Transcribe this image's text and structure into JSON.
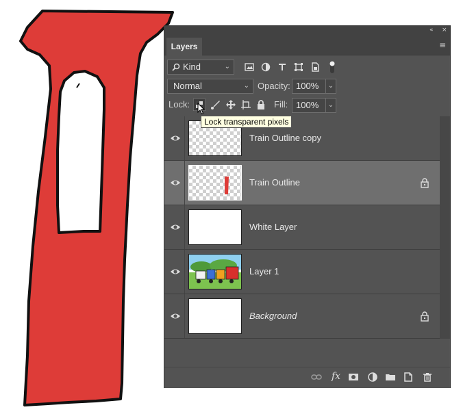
{
  "panel": {
    "tab_label": "Layers",
    "collapse_glyph": "«",
    "close_glyph": "×",
    "menu_glyph": "≡"
  },
  "filter": {
    "kind_label": "Kind",
    "search_icon": "search-icon",
    "type_icons": [
      "image-filter-icon",
      "adjustment-filter-icon",
      "type-filter-icon",
      "shape-filter-icon",
      "smart-object-filter-icon",
      "filter-toggle-icon"
    ]
  },
  "blend": {
    "mode": "Normal",
    "opacity_label": "Opacity:",
    "opacity_value": "100%"
  },
  "lock": {
    "label": "Lock:",
    "icons": [
      "lock-transparent-pixels-icon",
      "lock-image-pixels-icon",
      "lock-position-icon",
      "artboard-autonest-icon",
      "lock-all-icon"
    ],
    "fill_label": "Fill:",
    "fill_value": "100%"
  },
  "tooltip": "Lock transparent pixels",
  "layers": [
    {
      "name": "Train Outline copy",
      "thumb": "transparent",
      "selected": false,
      "locked": false,
      "italic": false
    },
    {
      "name": "Train Outline",
      "thumb": "transparent-red",
      "selected": true,
      "locked": true,
      "italic": false
    },
    {
      "name": "White Layer",
      "thumb": "white",
      "selected": false,
      "locked": false,
      "italic": false
    },
    {
      "name": "Layer 1",
      "thumb": "train-illustration",
      "selected": false,
      "locked": false,
      "italic": false
    },
    {
      "name": "Background",
      "thumb": "white",
      "selected": false,
      "locked": true,
      "italic": true
    }
  ],
  "bottom_icons": [
    "link-layers-icon",
    "fx-icon",
    "add-mask-icon",
    "adjustment-layer-icon",
    "new-group-icon",
    "new-layer-icon",
    "delete-layer-icon"
  ],
  "bottom_fx_label": "fx",
  "colors": {
    "panel_bg": "#535353",
    "selected_row": "#6f6f6f",
    "artwork_red": "#de3c38",
    "tooltip_bg": "#ffffe1"
  }
}
